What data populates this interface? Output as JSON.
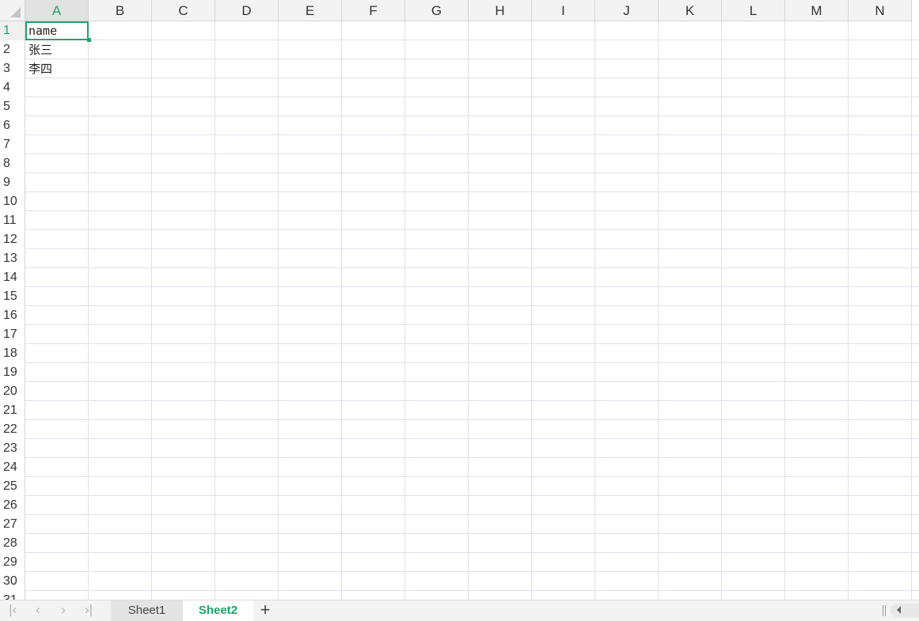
{
  "spreadsheet": {
    "active_cell": "A1",
    "columns": [
      "A",
      "B",
      "C",
      "D",
      "E",
      "F",
      "G",
      "H",
      "I",
      "J",
      "K",
      "L",
      "M",
      "N"
    ],
    "rows": [
      "1",
      "2",
      "3",
      "4",
      "5",
      "6",
      "7",
      "8",
      "9",
      "10",
      "11",
      "12",
      "13",
      "14",
      "15",
      "16",
      "17",
      "18",
      "19",
      "20",
      "21",
      "22",
      "23",
      "24",
      "25",
      "26",
      "27",
      "28",
      "29",
      "30",
      "31"
    ],
    "cells": {
      "A1": "name",
      "A2": "张三",
      "A3": "李四"
    }
  },
  "tabs": {
    "sheets": [
      "Sheet1",
      "Sheet2"
    ],
    "active": "Sheet2",
    "add_label": "+"
  },
  "nav": {
    "first": "|‹",
    "prev": "‹",
    "next": "›",
    "last": "›|"
  },
  "colors": {
    "accent": "#1fa36b",
    "gridline": "#dfe1ea",
    "header_bg": "#f3f3f3"
  }
}
